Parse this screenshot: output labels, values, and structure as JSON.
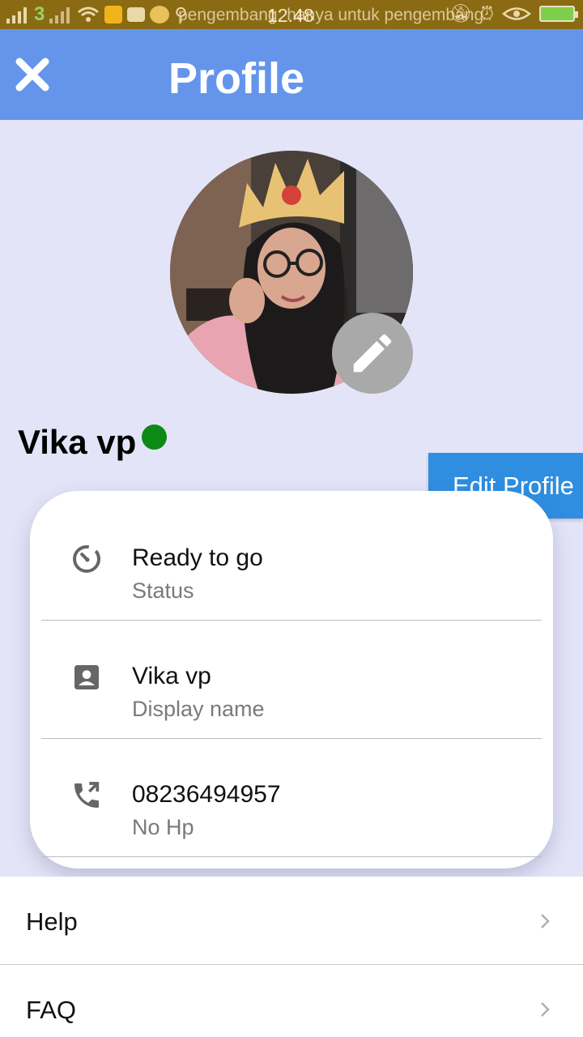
{
  "status_bar": {
    "time": "12.48",
    "notification_text": "pengembang: hanya untuk pengembang",
    "carrier_badge": "3"
  },
  "appbar": {
    "title": "Profile",
    "close_icon": "close-icon"
  },
  "profile": {
    "name": "Vika vp",
    "online": true,
    "edit_button_label": "Edit Profile",
    "online_color": "#0b8a15"
  },
  "info_rows": [
    {
      "icon": "status-timer-icon",
      "primary": "Ready to go",
      "secondary": "Status"
    },
    {
      "icon": "contact-card-icon",
      "primary": "Vika vp",
      "secondary": "Display name"
    },
    {
      "icon": "phone-forward-icon",
      "primary": "08236494957",
      "secondary": "No Hp"
    }
  ],
  "menu": [
    {
      "label": "Help"
    },
    {
      "label": "FAQ"
    }
  ],
  "colors": {
    "appbar": "#6495ea",
    "background": "#e3e4f8",
    "edit_button": "#2f8ee0"
  }
}
